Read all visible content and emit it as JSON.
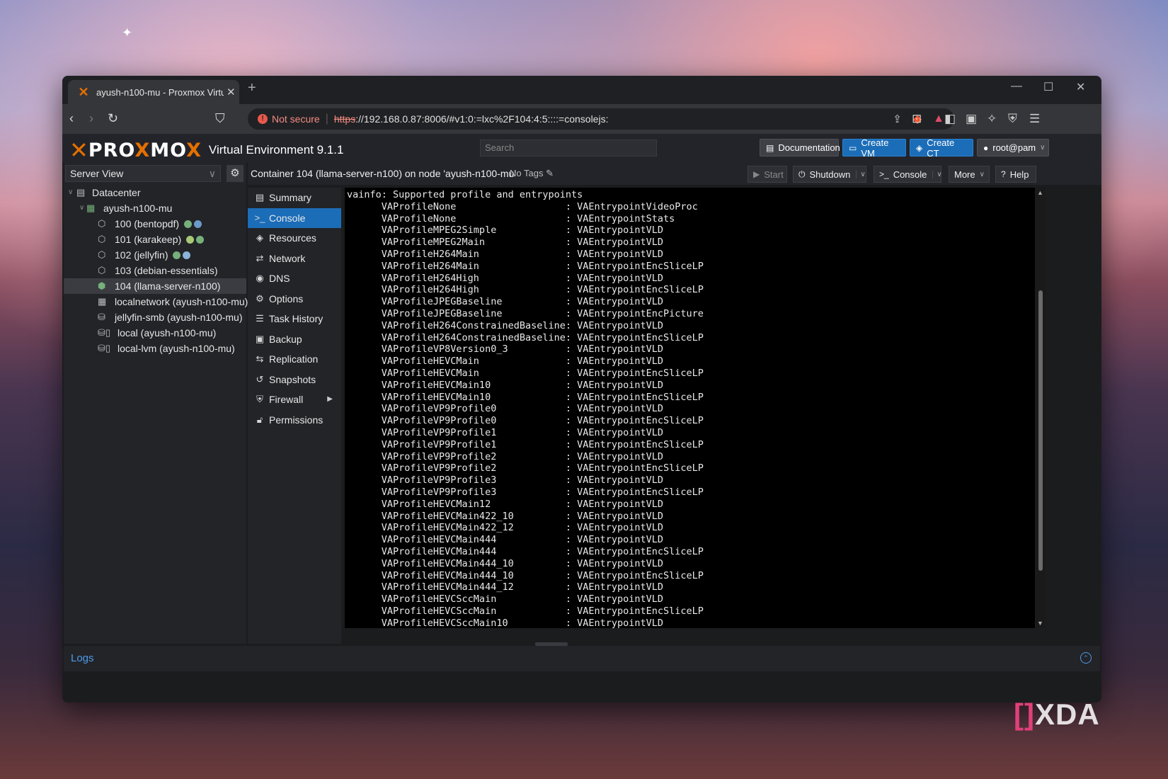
{
  "browser": {
    "tab_title": "ayush-n100-mu - Proxmox Virtu",
    "not_secure": "Not secure",
    "url_scheme": "https",
    "url_rest": "://192.168.0.87:8006/#v1:0:=lxc%2F104:4:5::::=consolejs:"
  },
  "header": {
    "brand": "PROXMOX",
    "product": "Virtual Environment 9.1.1",
    "search_placeholder": "Search",
    "documentation": "Documentation",
    "create_vm": "Create VM",
    "create_ct": "Create CT",
    "user": "root@pam"
  },
  "sidebar": {
    "view": "Server View",
    "tree": [
      {
        "label": "Datacenter"
      },
      {
        "label": "ayush-n100-mu"
      },
      {
        "label": "100 (bentopdf)"
      },
      {
        "label": "101 (karakeep)"
      },
      {
        "label": "102 (jellyfin)"
      },
      {
        "label": "103 (debian-essentials)"
      },
      {
        "label": "104 (llama-server-n100)"
      },
      {
        "label": "localnetwork (ayush-n100-mu)"
      },
      {
        "label": "jellyfin-smb (ayush-n100-mu)"
      },
      {
        "label": "local (ayush-n100-mu)"
      },
      {
        "label": "local-lvm (ayush-n100-mu)"
      }
    ]
  },
  "content": {
    "title": "Container 104 (llama-server-n100) on node 'ayush-n100-mu'",
    "no_tags": "No Tags",
    "start": "Start",
    "shutdown": "Shutdown",
    "console": "Console",
    "more": "More",
    "help": "Help",
    "menu": [
      {
        "label": "Summary",
        "icon": "summary-icon"
      },
      {
        "label": "Console",
        "icon": "console-icon"
      },
      {
        "label": "Resources",
        "icon": "resources-icon"
      },
      {
        "label": "Network",
        "icon": "network-icon"
      },
      {
        "label": "DNS",
        "icon": "dns-icon"
      },
      {
        "label": "Options",
        "icon": "options-icon"
      },
      {
        "label": "Task History",
        "icon": "task-history-icon"
      },
      {
        "label": "Backup",
        "icon": "backup-icon"
      },
      {
        "label": "Replication",
        "icon": "replication-icon"
      },
      {
        "label": "Snapshots",
        "icon": "snapshots-icon"
      },
      {
        "label": "Firewall",
        "icon": "firewall-icon"
      },
      {
        "label": "Permissions",
        "icon": "permissions-icon"
      }
    ],
    "console_text": "vainfo: Supported profile and entrypoints\n      VAProfileNone                   : VAEntrypointVideoProc\n      VAProfileNone                   : VAEntrypointStats\n      VAProfileMPEG2Simple            : VAEntrypointVLD\n      VAProfileMPEG2Main              : VAEntrypointVLD\n      VAProfileH264Main               : VAEntrypointVLD\n      VAProfileH264Main               : VAEntrypointEncSliceLP\n      VAProfileH264High               : VAEntrypointVLD\n      VAProfileH264High               : VAEntrypointEncSliceLP\n      VAProfileJPEGBaseline           : VAEntrypointVLD\n      VAProfileJPEGBaseline           : VAEntrypointEncPicture\n      VAProfileH264ConstrainedBaseline: VAEntrypointVLD\n      VAProfileH264ConstrainedBaseline: VAEntrypointEncSliceLP\n      VAProfileVP8Version0_3          : VAEntrypointVLD\n      VAProfileHEVCMain               : VAEntrypointVLD\n      VAProfileHEVCMain               : VAEntrypointEncSliceLP\n      VAProfileHEVCMain10             : VAEntrypointVLD\n      VAProfileHEVCMain10             : VAEntrypointEncSliceLP\n      VAProfileVP9Profile0            : VAEntrypointVLD\n      VAProfileVP9Profile0            : VAEntrypointEncSliceLP\n      VAProfileVP9Profile1            : VAEntrypointVLD\n      VAProfileVP9Profile1            : VAEntrypointEncSliceLP\n      VAProfileVP9Profile2            : VAEntrypointVLD\n      VAProfileVP9Profile2            : VAEntrypointEncSliceLP\n      VAProfileVP9Profile3            : VAEntrypointVLD\n      VAProfileVP9Profile3            : VAEntrypointEncSliceLP\n      VAProfileHEVCMain12             : VAEntrypointVLD\n      VAProfileHEVCMain422_10         : VAEntrypointVLD\n      VAProfileHEVCMain422_12         : VAEntrypointVLD\n      VAProfileHEVCMain444            : VAEntrypointVLD\n      VAProfileHEVCMain444            : VAEntrypointEncSliceLP\n      VAProfileHEVCMain444_10         : VAEntrypointVLD\n      VAProfileHEVCMain444_10         : VAEntrypointEncSliceLP\n      VAProfileHEVCMain444_12         : VAEntrypointVLD\n      VAProfileHEVCSccMain            : VAEntrypointVLD\n      VAProfileHEVCSccMain            : VAEntrypointEncSliceLP\n      VAProfileHEVCSccMain10          : VAEntrypointVLD"
  },
  "logs": {
    "label": "Logs"
  },
  "watermark": {
    "left": "[",
    "right": "]",
    "text": "XDA"
  },
  "colors": {
    "accent": "#1b6db8",
    "brand_orange": "#e57000",
    "link": "#4c9be8"
  }
}
